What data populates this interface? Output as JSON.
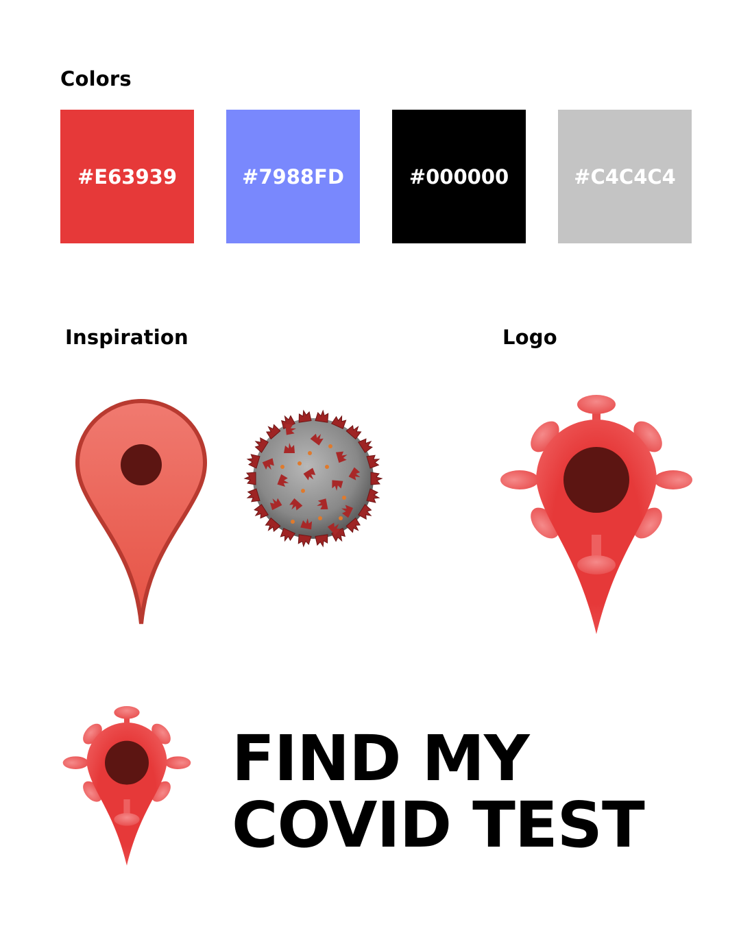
{
  "sections": {
    "colors_heading": "Colors",
    "inspiration_heading": "Inspiration",
    "logo_heading": "Logo"
  },
  "palette": [
    {
      "label": "#E63939",
      "color": "#E63939"
    },
    {
      "label": "#7988FD",
      "color": "#7988FD"
    },
    {
      "label": "#000000",
      "color": "#000000"
    },
    {
      "label": "#C4C4C4",
      "color": "#C4C4C4"
    }
  ],
  "icons": {
    "inspiration_pin": "map-pin-icon",
    "inspiration_virus": "coronavirus-icon",
    "logo": "virus-pin-logo-icon"
  },
  "wordmark": {
    "line1": "FIND MY",
    "line2": "COVID TEST"
  }
}
